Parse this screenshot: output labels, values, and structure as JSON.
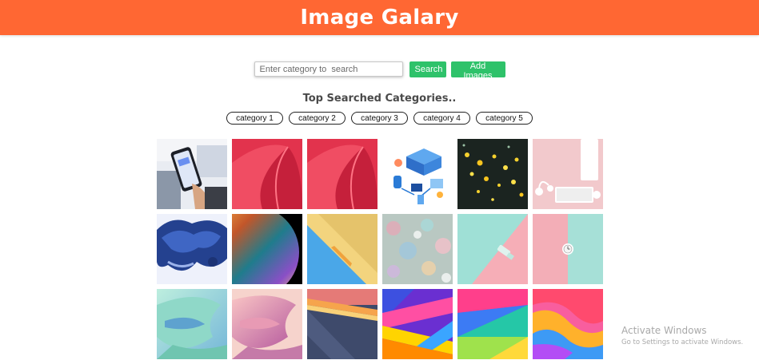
{
  "header": {
    "title": "Image Galary"
  },
  "search": {
    "placeholder": "Enter category to  search",
    "value": "",
    "search_label": "Search",
    "add_label": "Add Images"
  },
  "top_categories": {
    "title": "Top Searched Categories..",
    "items": [
      "category 1",
      "category 2",
      "category 3",
      "category 4",
      "category 5"
    ]
  },
  "gallery": {
    "images": [
      {
        "icon": "phone-app-photo"
      },
      {
        "icon": "red-paper-fold-abstract"
      },
      {
        "icon": "red-paper-fold-abstract"
      },
      {
        "icon": "isometric-tech-illustration"
      },
      {
        "icon": "bokeh-lights-dark"
      },
      {
        "icon": "pink-desk-keyboard"
      },
      {
        "icon": "blue-ink-cloud"
      },
      {
        "icon": "iridescent-bubble-planet"
      },
      {
        "icon": "yellow-blue-pencil-geometric"
      },
      {
        "icon": "colorful-bokeh-blur"
      },
      {
        "icon": "mint-pink-geometric-usb"
      },
      {
        "icon": "pink-mint-clock"
      },
      {
        "icon": "mint-blue-wave-abstract"
      },
      {
        "icon": "pink-gradient-wave-abstract"
      },
      {
        "icon": "material-stripes-navy"
      },
      {
        "icon": "purple-yellow-stripes"
      },
      {
        "icon": "blue-green-yellow-geometric"
      },
      {
        "icon": "orange-pink-fluid-waves"
      }
    ]
  },
  "watermark": {
    "line1": "Activate Windows",
    "line2": "Go to Settings to activate Windows."
  },
  "colors": {
    "header_bg": "#ff6733",
    "button_bg": "#2ec26a",
    "heading_text": "#4a4a4a"
  }
}
